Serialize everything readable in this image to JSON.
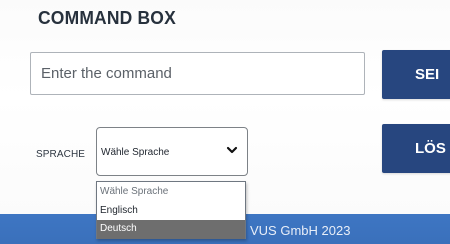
{
  "command_box": {
    "title": "COMMAND BOX",
    "input_placeholder": "Enter the command",
    "send_button_label": "SEI",
    "clear_button_label": "LÖS"
  },
  "language": {
    "label": "SPRACHE",
    "selected_value": "Wähle Sprache",
    "options": [
      "Wähle Sprache",
      "Englisch",
      "Deutsch"
    ],
    "highlighted_option": "Deutsch"
  },
  "footer": {
    "text": "VUS GmbH 2023"
  },
  "icons": {
    "dropdown": "chevron-down-icon"
  },
  "colors": {
    "button_blue": "#27467f",
    "footer_blue": "#3e76c3",
    "highlighted_option_gray": "#6e6e6e"
  }
}
